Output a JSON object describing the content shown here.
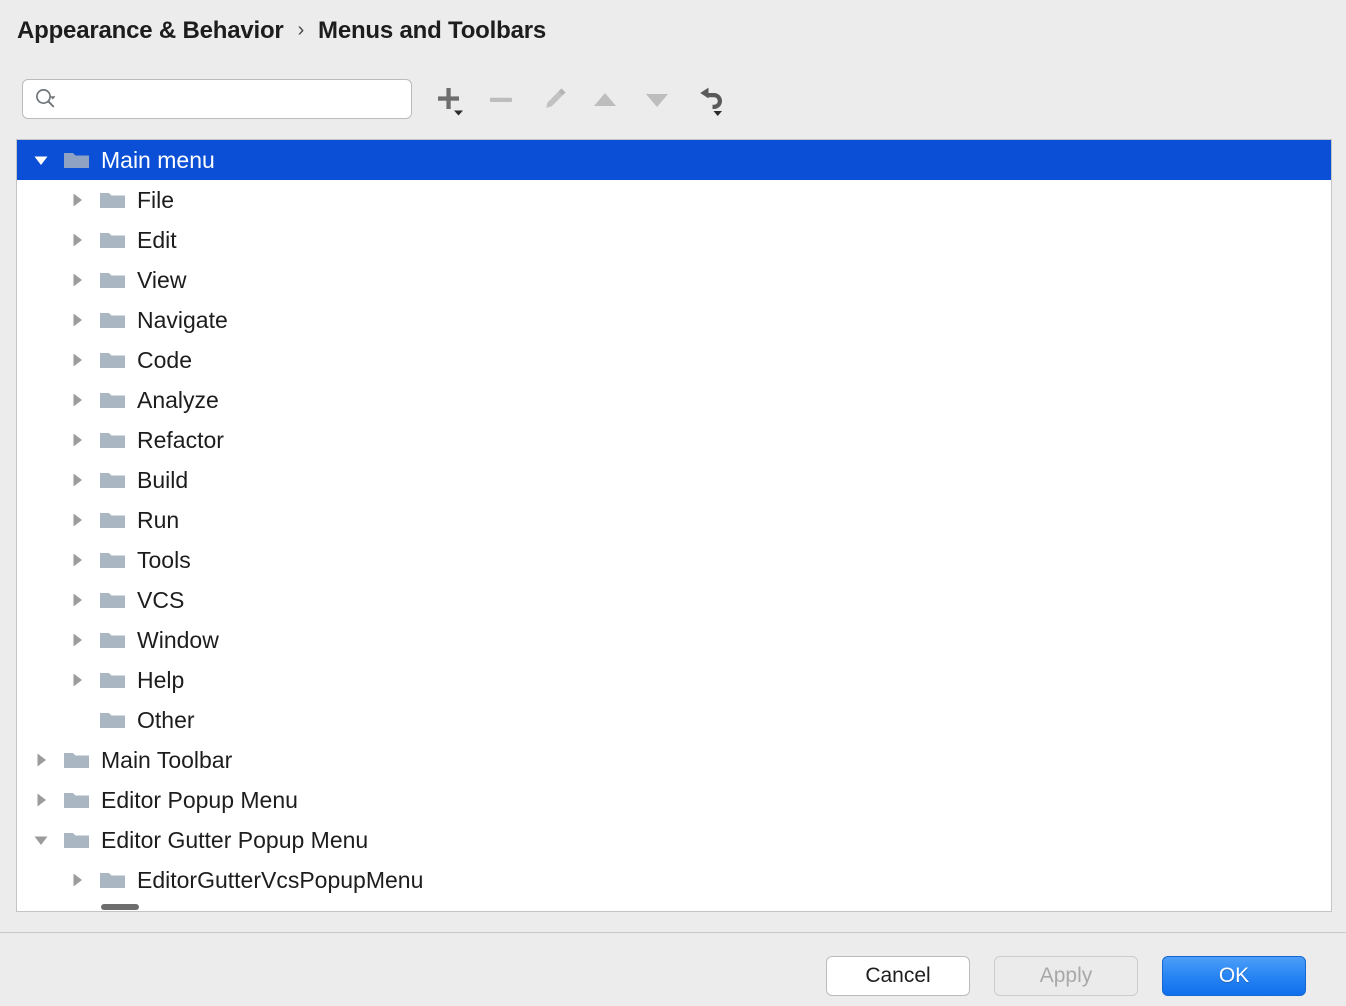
{
  "breadcrumb": {
    "parent": "Appearance & Behavior",
    "separator": "›",
    "current": "Menus and Toolbars"
  },
  "search": {
    "value": "",
    "placeholder": "",
    "icon": "search-icon",
    "dropdown_icon": "chevron-down-icon"
  },
  "toolbar": {
    "buttons": [
      {
        "name": "add-button",
        "icon": "plus-icon",
        "label": "Add",
        "enabled": true,
        "has_dropdown": true
      },
      {
        "name": "remove-button",
        "icon": "minus-icon",
        "label": "Remove",
        "enabled": false,
        "has_dropdown": false
      },
      {
        "name": "edit-button",
        "icon": "pencil-icon",
        "label": "Edit",
        "enabled": false,
        "has_dropdown": false
      },
      {
        "name": "move-up-button",
        "icon": "arrow-up-icon",
        "label": "Move Up",
        "enabled": false,
        "has_dropdown": false
      },
      {
        "name": "move-down-button",
        "icon": "arrow-down-icon",
        "label": "Move Down",
        "enabled": false,
        "has_dropdown": false
      },
      {
        "name": "restore-button",
        "icon": "revert-arrow-icon",
        "label": "Restore",
        "enabled": true,
        "has_dropdown": true
      }
    ]
  },
  "tree": {
    "rows": [
      {
        "label": "Main menu",
        "depth": 0,
        "state": "expanded",
        "selected": true
      },
      {
        "label": "File",
        "depth": 1,
        "state": "collapsed",
        "selected": false
      },
      {
        "label": "Edit",
        "depth": 1,
        "state": "collapsed",
        "selected": false
      },
      {
        "label": "View",
        "depth": 1,
        "state": "collapsed",
        "selected": false
      },
      {
        "label": "Navigate",
        "depth": 1,
        "state": "collapsed",
        "selected": false
      },
      {
        "label": "Code",
        "depth": 1,
        "state": "collapsed",
        "selected": false
      },
      {
        "label": "Analyze",
        "depth": 1,
        "state": "collapsed",
        "selected": false
      },
      {
        "label": "Refactor",
        "depth": 1,
        "state": "collapsed",
        "selected": false
      },
      {
        "label": "Build",
        "depth": 1,
        "state": "collapsed",
        "selected": false
      },
      {
        "label": "Run",
        "depth": 1,
        "state": "collapsed",
        "selected": false
      },
      {
        "label": "Tools",
        "depth": 1,
        "state": "collapsed",
        "selected": false
      },
      {
        "label": "VCS",
        "depth": 1,
        "state": "collapsed",
        "selected": false
      },
      {
        "label": "Window",
        "depth": 1,
        "state": "collapsed",
        "selected": false
      },
      {
        "label": "Help",
        "depth": 1,
        "state": "collapsed",
        "selected": false
      },
      {
        "label": "Other",
        "depth": 1,
        "state": "leaf",
        "selected": false
      },
      {
        "label": "Main Toolbar",
        "depth": 0,
        "state": "collapsed",
        "selected": false
      },
      {
        "label": "Editor Popup Menu",
        "depth": 0,
        "state": "collapsed",
        "selected": false
      },
      {
        "label": "Editor Gutter Popup Menu",
        "depth": 0,
        "state": "expanded",
        "selected": false
      },
      {
        "label": "EditorGutterVcsPopupMenu",
        "depth": 1,
        "state": "collapsed",
        "selected": false
      },
      {
        "label": "",
        "depth": 1,
        "state": "leaf",
        "selected": false
      }
    ],
    "folder_icon": "folder-icon",
    "expanded_icon": "triangle-down-icon",
    "collapsed_icon": "triangle-right-icon"
  },
  "footer": {
    "cancel_label": "Cancel",
    "apply_label": "Apply",
    "ok_label": "OK"
  },
  "colors": {
    "selection_blue": "#0a4fd6",
    "ok_button_blue": "#2a86f4",
    "folder_gray": "#aab7c2",
    "window_background": "#ececec",
    "panel_background": "#ffffff"
  }
}
